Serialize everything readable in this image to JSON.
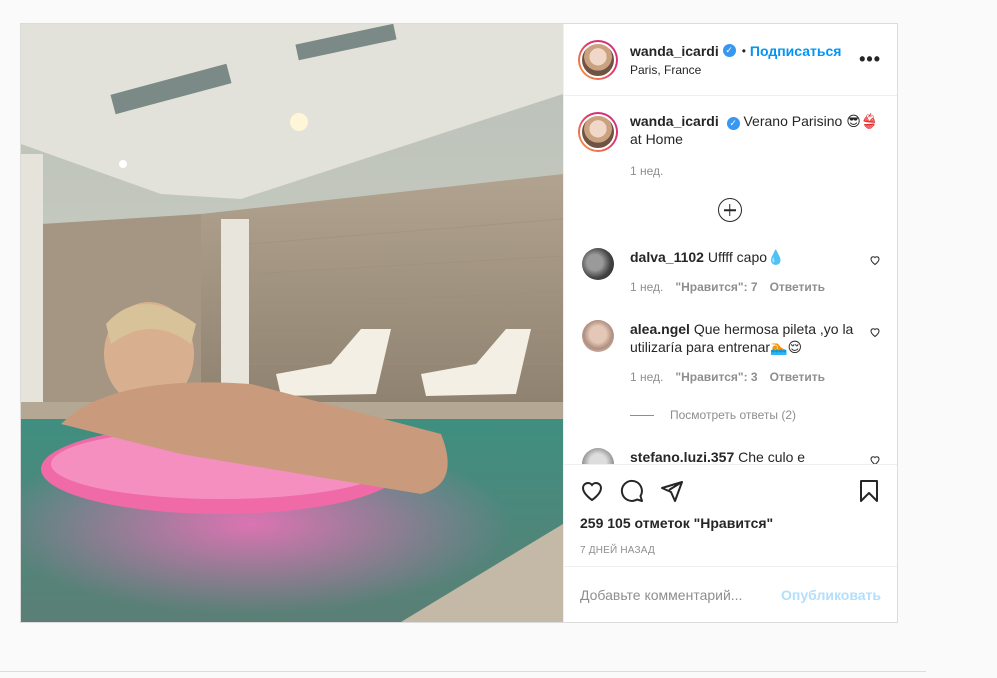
{
  "post": {
    "author": {
      "username": "wanda_icardi",
      "verified": true,
      "follow_label": "Подписаться",
      "location": "Paris, France"
    },
    "more_label": "•••",
    "caption": {
      "text": "Verano Parisino 😎👙 at Home",
      "age": "1 нед."
    },
    "comments": [
      {
        "username": "dalva_1102",
        "text": "Uffff capo💧",
        "age": "1 нед.",
        "likes_label": "\"Нравится\": 7",
        "reply_label": "Ответить"
      },
      {
        "username": "alea.ngel",
        "text": "Que hermosa pileta ,yo la utilizaría para entrenar🏊😌",
        "age": "1 нед.",
        "likes_label": "\"Нравится\": 3",
        "reply_label": "Ответить",
        "view_replies": "Посмотреть ответы (2)"
      },
      {
        "username": "stefano.luzi.357",
        "text": "Che culo e"
      }
    ],
    "likes_text": "259 105 отметок \"Нравится\"",
    "timestamp": "7 ДНЕЙ НАЗАД",
    "add_comment": {
      "placeholder": "Добавьте комментарий...",
      "publish_label": "Опубликовать"
    }
  },
  "colors": {
    "accent": "#0095f6",
    "publish_disabled": "#b2dffc",
    "muted": "#8e8e8e"
  },
  "icons": [
    "heart-icon",
    "comment-icon",
    "share-icon",
    "bookmark-icon",
    "verified-icon",
    "more-icon",
    "load-more-icon"
  ]
}
